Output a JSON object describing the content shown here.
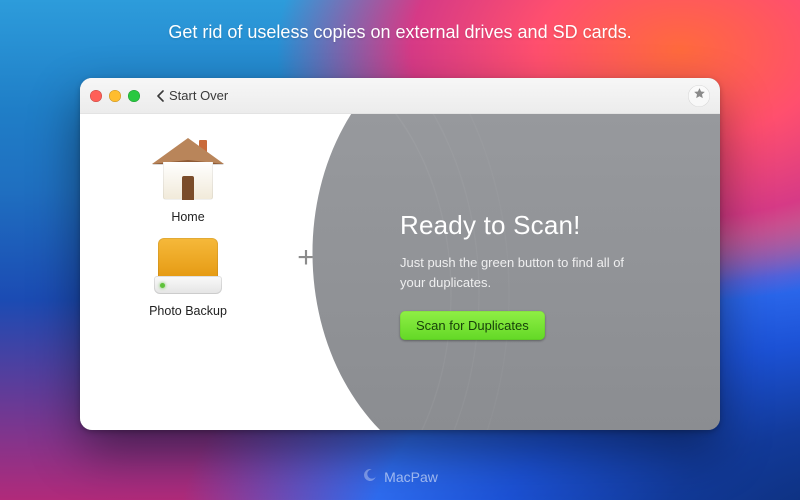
{
  "marketing": {
    "tagline": "Get rid of useless copies on external drives and SD cards.",
    "brand": "MacPaw"
  },
  "window": {
    "titlebar": {
      "start_over_label": "Start Over"
    },
    "sources": [
      {
        "kind": "home",
        "label": "Home"
      },
      {
        "kind": "drive",
        "label": "Photo Backup"
      }
    ],
    "add_icon_glyph": "+",
    "ready": {
      "title": "Ready to Scan!",
      "subtitle": "Just push the green button to find all of your duplicates.",
      "scan_button_label": "Scan for Duplicates"
    },
    "colors": {
      "scan_button_bg_top": "#8fef45",
      "scan_button_bg_bottom": "#63d826"
    }
  }
}
